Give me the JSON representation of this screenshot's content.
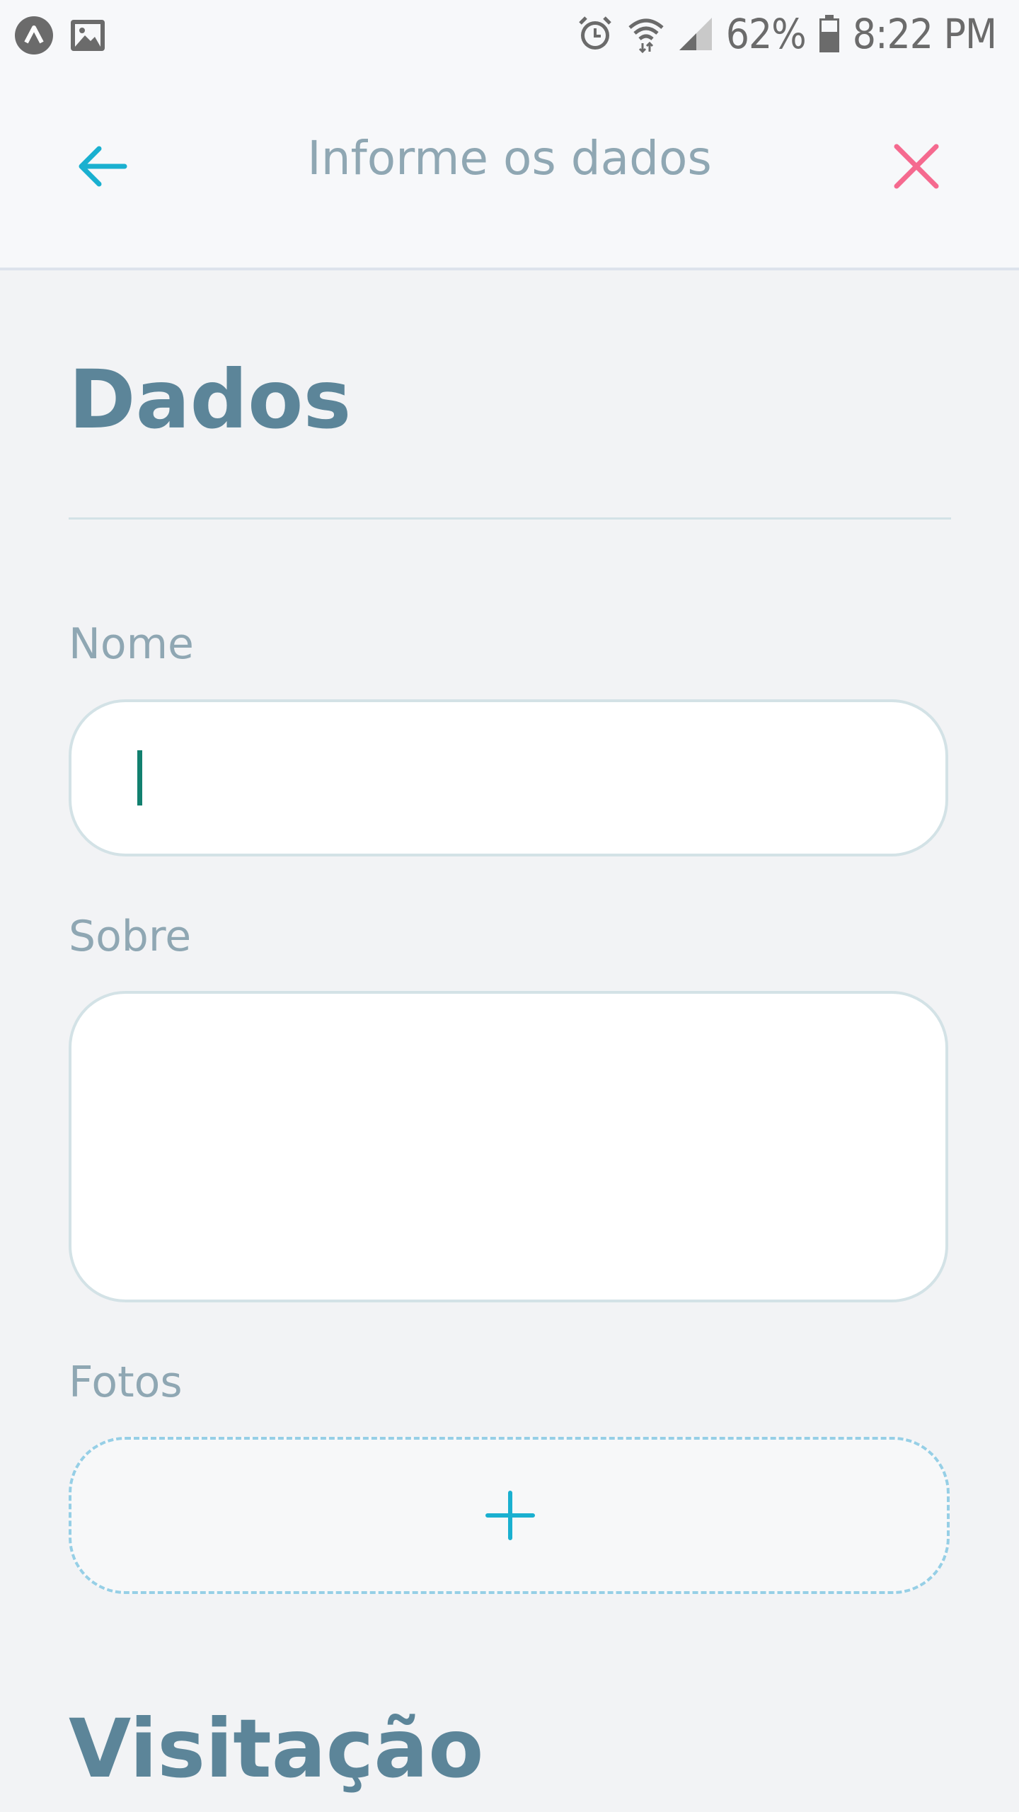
{
  "status_bar": {
    "battery": "62%",
    "time": "8:22 PM",
    "icons": [
      "app-logo-icon",
      "image-icon",
      "alarm-icon",
      "wifi-icon",
      "signal-icon",
      "battery-icon"
    ]
  },
  "header": {
    "title": "Informe os dados",
    "back_icon": "arrow-left-icon",
    "close_icon": "close-icon",
    "accent_color": "#1ab0d0",
    "close_color": "#f56a8f"
  },
  "form": {
    "section_title": "Dados",
    "name_label": "Nome",
    "name_value": "",
    "about_label": "Sobre",
    "about_value": "",
    "photos_label": "Fotos",
    "add_photo_icon": "plus-icon"
  },
  "next_section_title": "Visitação"
}
